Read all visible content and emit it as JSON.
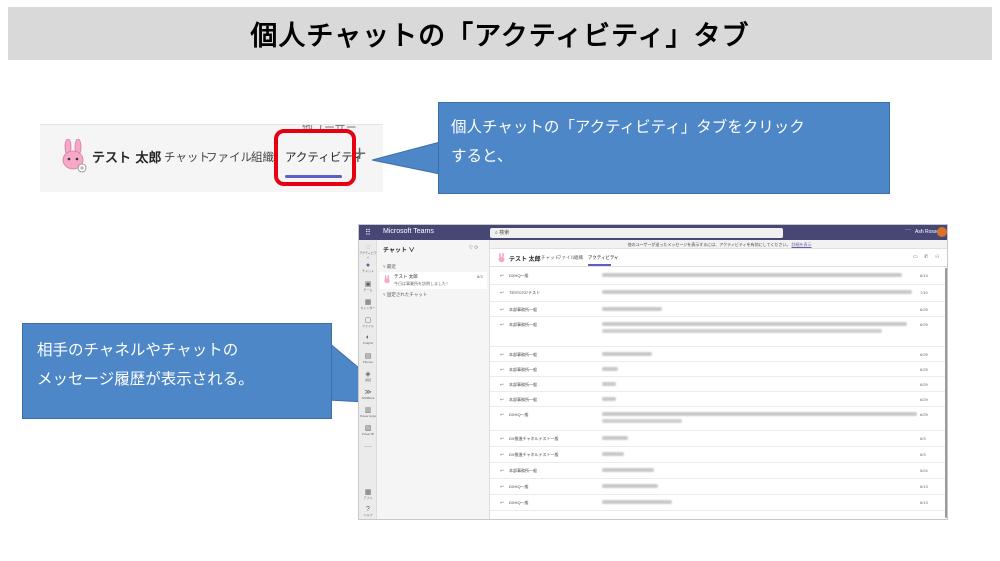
{
  "title": "個人チャットの「アクティビティ」タブ",
  "zoom": {
    "cut_text": "他ユーザー",
    "name": "テスト 太郎",
    "tabs": [
      "チャット",
      "ファイル",
      "組織",
      "アクティビティ"
    ],
    "plus": "+"
  },
  "callout1": {
    "line1": "個人チャットの「アクティビティ」タブをクリック",
    "line2": "すると、"
  },
  "callout2": {
    "line1": "相手のチャネルやチャットの",
    "line2": "メッセージ履歴が表示される。"
  },
  "teams": {
    "app_title": "Microsoft Teams",
    "search_placeholder": "検索",
    "user_name": "Ash Rosse",
    "rail": [
      {
        "icon": "◌",
        "label": "アクティビティ"
      },
      {
        "icon": "●",
        "label": "チャット"
      },
      {
        "icon": "▣",
        "label": "チーム"
      },
      {
        "icon": "▦",
        "label": "カレンダー"
      },
      {
        "icon": "▢",
        "label": "ファイル"
      },
      {
        "icon": "◐",
        "label": "Insights"
      },
      {
        "icon": "▤",
        "label": "Planner"
      },
      {
        "icon": "◈",
        "label": "通話"
      },
      {
        "icon": "≫",
        "label": "ShiftBook"
      },
      {
        "icon": "▥",
        "label": "Power Apps"
      },
      {
        "icon": "▧",
        "label": "Power BI"
      },
      {
        "icon": "…",
        "label": ""
      },
      {
        "icon": "▦",
        "label": "アプリ"
      },
      {
        "icon": "?",
        "label": "ヘルプ"
      }
    ],
    "list_header": "チャット ∨",
    "section_recent": "˅ 最近",
    "chat_name": "テスト 太郎",
    "chat_preview": "今日は事業所を訪問しました！",
    "chat_time": "8/3",
    "section_pinned": "˅ 固定されたチャット",
    "banner": "他のユーザーが送ったメッセージを表示するには、アクティビティを有効にしてください。",
    "banner_link": "詳細を表示",
    "head_name": "テスト 太郎",
    "head_tabs": [
      "チャット",
      "ファイル",
      "組織",
      "アクティビティ"
    ],
    "rows": [
      {
        "who": "DXHQ一般",
        "date": "6/13"
      },
      {
        "who": "TEST0707テスト",
        "date": "7/10"
      },
      {
        "who": "本部事務所一般",
        "date": "6/29"
      },
      {
        "who": "本部事務所一般",
        "date": "6/29"
      },
      {
        "who": "本部事務所一般",
        "date": "6/29"
      },
      {
        "who": "本部事務所一般",
        "date": "6/29"
      },
      {
        "who": "本部事務所一般",
        "date": "6/29"
      },
      {
        "who": "本部事務所一般",
        "date": "6/29"
      },
      {
        "who": "DXHQ一般",
        "date": "6/29"
      },
      {
        "who": "DX推進チャネルテスト一般",
        "date": "6/3"
      },
      {
        "who": "DX推進チャネルテスト一般",
        "date": "6/3"
      },
      {
        "who": "本部事務所一般",
        "date": "5/24"
      },
      {
        "who": "DXHQ一般",
        "date": "6/13"
      },
      {
        "who": "DXHQ一般",
        "date": "6/13"
      }
    ]
  },
  "colors": {
    "accent": "#5b5fc7",
    "callout": "#4e87c8",
    "highlight": "#e60012",
    "title_bg": "#d9d9d9",
    "teams_bar": "#464775"
  }
}
